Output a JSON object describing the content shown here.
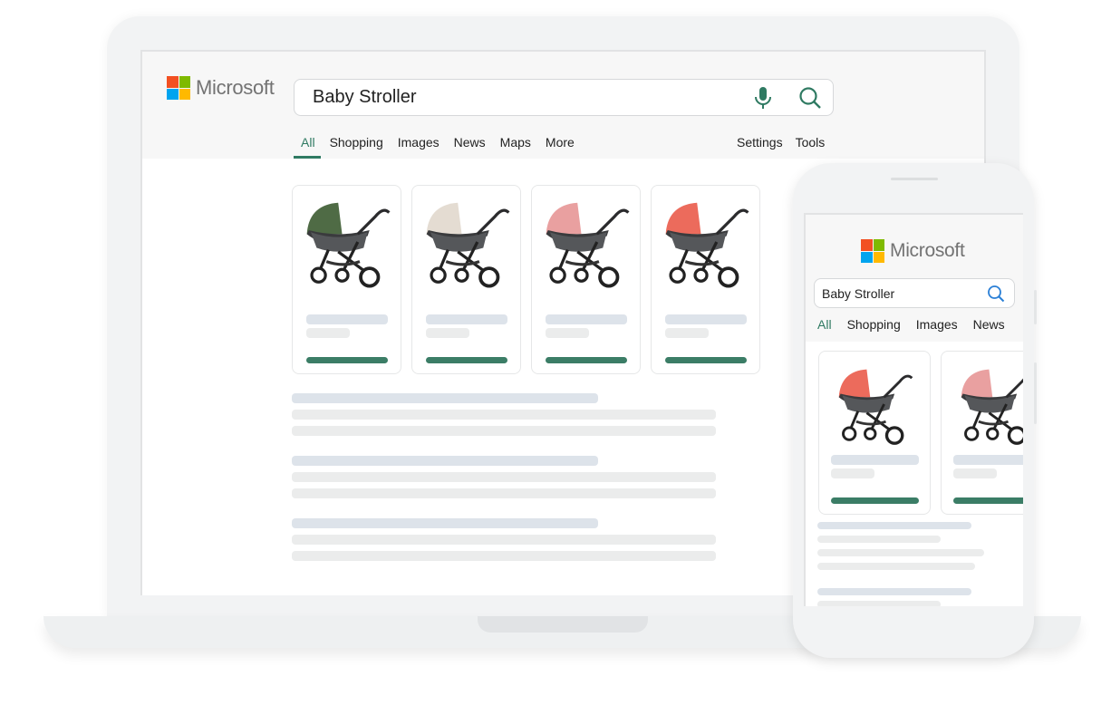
{
  "laptop": {
    "brand": "Microsoft",
    "search": {
      "value": "Baby Stroller",
      "mic_icon": "microphone-icon",
      "search_icon": "search-icon"
    },
    "tabs": [
      "All",
      "Shopping",
      "Images",
      "News",
      "Maps",
      "More"
    ],
    "right_tabs": [
      "Settings",
      "Tools"
    ],
    "active_tab": "All",
    "products": [
      {
        "image": "stroller-green",
        "canopy": "#4f6b45"
      },
      {
        "image": "stroller-beige",
        "canopy": "#e4dcd2"
      },
      {
        "image": "stroller-pink",
        "canopy": "#e9a0a0"
      },
      {
        "image": "stroller-coral",
        "canopy": "#ec6b5c"
      }
    ]
  },
  "phone": {
    "brand": "Microsoft",
    "search": {
      "value": "Baby Stroller",
      "search_icon": "search-icon"
    },
    "tabs": [
      "All",
      "Shopping",
      "Images",
      "News"
    ],
    "active_tab": "All",
    "products": [
      {
        "image": "stroller-coral",
        "canopy": "#ec6b5c"
      },
      {
        "image": "stroller-pink",
        "canopy": "#e9a0a0"
      }
    ]
  },
  "colors": {
    "accent": "#2f7a62",
    "placeholder_blue": "#dde3ea",
    "placeholder_grey": "#ebecec"
  }
}
